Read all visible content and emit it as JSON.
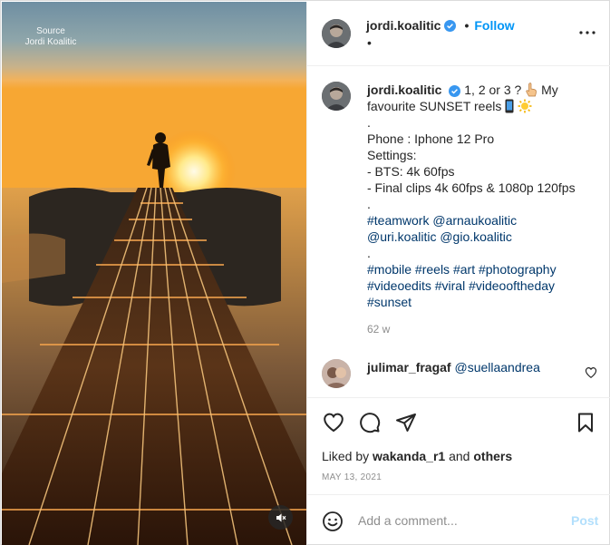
{
  "media": {
    "watermark_line1": "Source",
    "watermark_line2": "Jordi Koalitic",
    "mute_icon": "speaker-muted-icon"
  },
  "header": {
    "username": "jordi.koalitic",
    "verified_icon": "verified-badge-icon",
    "separator": "•",
    "follow_label": "Follow",
    "sub_line": "•",
    "more_icon": "more-options-icon"
  },
  "caption": {
    "username": "jordi.koalitic",
    "line1_text": "1, 2 or 3 ?",
    "line2_text": "favourite SUNSET reels",
    "line1_tail": "My",
    "lines": [
      ".",
      "Phone : Iphone 12 Pro",
      "Settings:",
      "- BTS: 4k 60fps",
      "- Final clips 4k 60fps & 1080p 120fps",
      "."
    ],
    "tags_1": [
      "#teamwork",
      "@arnaukoalitic"
    ],
    "tags_2": [
      "@uri.koalitic",
      "@gio.koalitic"
    ],
    "dot_after_tags": ".",
    "tags_3": [
      "#mobile",
      "#reels",
      "#art",
      "#photography"
    ],
    "tags_4": [
      "#videoedits",
      "#viral",
      "#videooftheday"
    ],
    "tags_5": [
      "#sunset"
    ],
    "time": "62 w"
  },
  "comment": {
    "username": "julimar_fragaf",
    "mention": "@suellaandrea",
    "next_peek": "· · ·"
  },
  "actions": {
    "liked_prefix": "Liked by",
    "liked_user": "wakanda_r1",
    "liked_and": "and",
    "liked_others": "others",
    "date": "MAY 13, 2021"
  },
  "add_comment": {
    "placeholder": "Add a comment...",
    "post_label": "Post"
  },
  "colors": {
    "accent": "#0095f6",
    "link": "#00376b",
    "muted": "#8e8e8e",
    "post_disabled": "#b2dffc"
  }
}
